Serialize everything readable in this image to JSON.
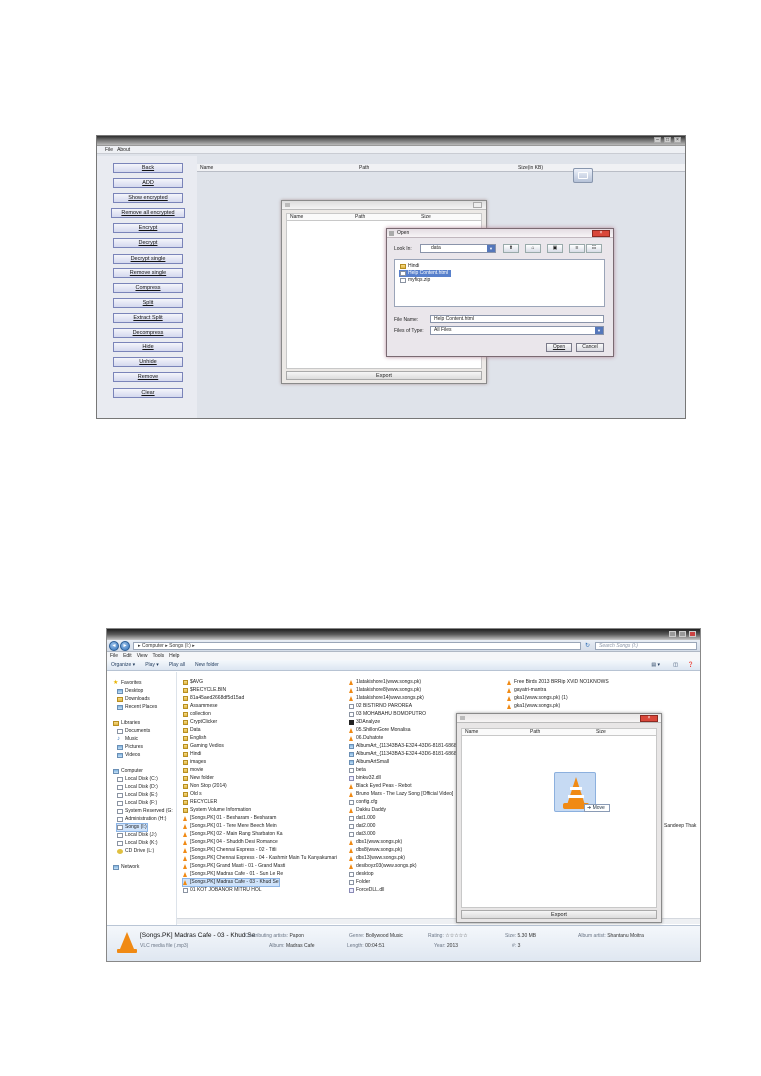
{
  "app": {
    "menu": [
      "File",
      "About"
    ],
    "buttons": [
      "Back",
      "ADD",
      "Show encrypted",
      "Remove all encrypted",
      "Encrypt",
      "Decrypt",
      "Decrypt single",
      "Remove single",
      "Compress",
      "Split",
      "Extract Split",
      "Decompress",
      "Hide",
      "Unhide",
      "Remove",
      "Clear"
    ],
    "columns": {
      "name": "Name",
      "path": "Path",
      "size": "Size(in KB)"
    }
  },
  "dialog1": {
    "columns": {
      "name": "Name",
      "path": "Path",
      "size": "Size"
    },
    "export_label": "Export"
  },
  "open_dialog": {
    "title": "Open",
    "look_in_label": "Look In:",
    "look_in_value": "data",
    "files": [
      "Hindi",
      "Help Content.html",
      "myfiqs.zip"
    ],
    "file_name_label": "File Name:",
    "file_name_value": "Help Content.html",
    "files_of_type_label": "Files of Type:",
    "files_of_type_value": "All Files",
    "open_label": "Open",
    "cancel_label": "Cancel"
  },
  "explorer": {
    "breadcrumb": "▸ Computer ▸ Songs (I:) ▸",
    "search_placeholder": "Search Songs (I:)",
    "menu": [
      "File",
      "Edit",
      "View",
      "Tools",
      "Help"
    ],
    "commands": [
      "Organize ▾",
      "Play ▾",
      "Play all",
      "New folder"
    ],
    "nav": {
      "favorites": [
        "Favorites",
        "Desktop",
        "Downloads",
        "Recent Places"
      ],
      "libraries": [
        "Libraries",
        "Documents",
        "Music",
        "Pictures",
        "Videos"
      ],
      "computer": [
        "Computer",
        "Local Disk (C:)",
        "Local Disk (D:)",
        "Local Disk (E:)",
        "Local Disk (F:)",
        "System Reserved (G:",
        "Administration (H:)",
        "Songs (I:)",
        "Local Disk (J:)",
        "Local Disk (K:)",
        "CD Drive (L:)"
      ],
      "network": "Network"
    },
    "col1": [
      "$AVG",
      "$RECYCLE.BIN",
      "81a45aed2668df5d15ad",
      "Assammese",
      "collection",
      "CryptClicker",
      "Data",
      "English",
      "Gaming Vedios",
      "Hindi",
      "images",
      "movie",
      "New folder",
      "Non Stop (2014)",
      "Old s",
      "RECYCLER",
      "System Volume Information",
      "[Songs.PK] 01 - Besharam - Besharam",
      "[Songs.PK] 01 - Tere Mere Beech Mein",
      "[Songs.PK] 02 - Main Rang Sharbaton Ka",
      "[Songs.PK] 04 - Shuddh Desi Romance",
      "[Songs.PK] Chennai Express - 02 - Titli",
      "[Songs.PK] Chennai Express - 04 - Kashmir Main Tu Kanyakumari",
      "[Songs.PK] Grand Masti - 01 - Grand Masti",
      "[Songs.PK] Madras Cafe - 01 - Sun Le Re",
      "[Songs.PK] Madras Cafe - 03 - Khud Se",
      "01 KOT JOBANOR MITRU HOL"
    ],
    "col2": [
      "1latakishore1(www.songs.pk)",
      "1latakishore8(www.songs.pk)",
      "1latakishore14(www.songs.pk)",
      "02 BISTIRNO PAROREA",
      "03 MOHABAHU BOMOPUTRO",
      "3DAnalyze",
      "05.ShillonGore Monalisa",
      "06.Duhatote",
      "AlbumArt_{11343BA3-E324-43D6-8181-6868",
      "AlbumArt_{11343BA3-E324-43D6-8181-6868",
      "AlbumArtSmall",
      "beta",
      "binkw32.dll",
      "Black Eyed Peas - Rebot",
      "Bruno Mars - The Lazy Song [Official Video]",
      "config.cfg",
      "Dakku Daddy",
      "dat1.000",
      "dat2.000",
      "dat3.000",
      "dbs1(www.songs.pk)",
      "dbs8(www.songs.pk)",
      "dbs13(www.songs.pk)",
      "desiboyz03(www.songs.pk)",
      "desktop",
      "Folder",
      "ForceDLL.dll"
    ],
    "col3": [
      "Free Birds 2013 BRRip XViD NO1KNOWS",
      "gayatri-mantra",
      "gka1(www.songs.pk) (1)",
      "gka1(www.songs.pk)"
    ],
    "col4_partial": "Sandeep Thak",
    "details": {
      "filename": "[Songs.PK] Madras Cafe - 03 - Khud Se",
      "type": "VLC media file (.mp3)",
      "contributing_label": "Contributing artists:",
      "contributing": "Papon",
      "album_label": "Album:",
      "album": "Madras Cafe",
      "genre_label": "Genre:",
      "genre": "Bollywood Music",
      "length_label": "Length:",
      "length": "00:04:51",
      "rating_label": "Rating:",
      "rating_stars": "☆☆☆☆☆",
      "year_label": "Year:",
      "year": "2013",
      "size_label": "Size:",
      "size": "5.30 MB",
      "num_label": "#:",
      "num": "3",
      "album_artist_label": "Album artist:",
      "album_artist": "Shantanu Moitra"
    }
  },
  "dialog2": {
    "columns": {
      "name": "Name",
      "path": "Path",
      "size": "Size"
    },
    "move_label": "Move",
    "export_label": "Export"
  }
}
